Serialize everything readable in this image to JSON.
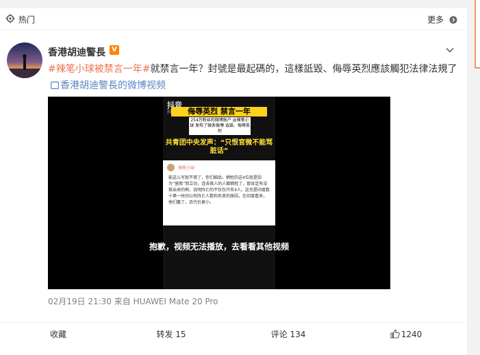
{
  "topbar": {
    "hot_label": "热门",
    "more_label": "更多"
  },
  "post": {
    "username": "香港胡迪警長",
    "vip_badge": "V",
    "topic": "#辣笔小球被禁言一年#",
    "text": "就禁言一年？封號是最起碼的，這樣詆毀、侮辱英烈應該觸犯法律法規了",
    "video_link_label": "香港胡迪警長的微博视频",
    "timestamp": "02月19日 21:30",
    "source": "来自 HUAWEI Mate 20 Pro"
  },
  "video": {
    "watermark": "抖音",
    "watermark_id": "抖音号",
    "banner_title": "侮辱英烈 禁言一年",
    "banner_sub": "254万粉丝的微博账户 @辣笔小球 发布了微条微博 诋毁、侮辱英烈",
    "headline": "共青团中央发声：“只恨官微不能骂脏话”",
    "shot_name": "辣笔小球",
    "shot_text": "能这么写就不错了，你们细品，牺牲的这4位就是因为“营救”而立功，连去救人的人都牺牲了，那肯定有没救出来的啊，说明阵亡的不仅仅只有4人。这也是印度数十第一时间公布阵亡人数和名单的原因，在印度看来，他们赢了，且代价更小。",
    "error_message": "抱歉，视频无法播放，去看看其他视频"
  },
  "actions": {
    "favorite": "收藏",
    "repost": "转发 15",
    "comment": "评论 134",
    "like": "1240"
  },
  "colors": {
    "topic": "#eb7350",
    "link": "#5a86c4",
    "accent": "#f7925c",
    "meta": "#808080",
    "banner": "#fcd21c"
  }
}
